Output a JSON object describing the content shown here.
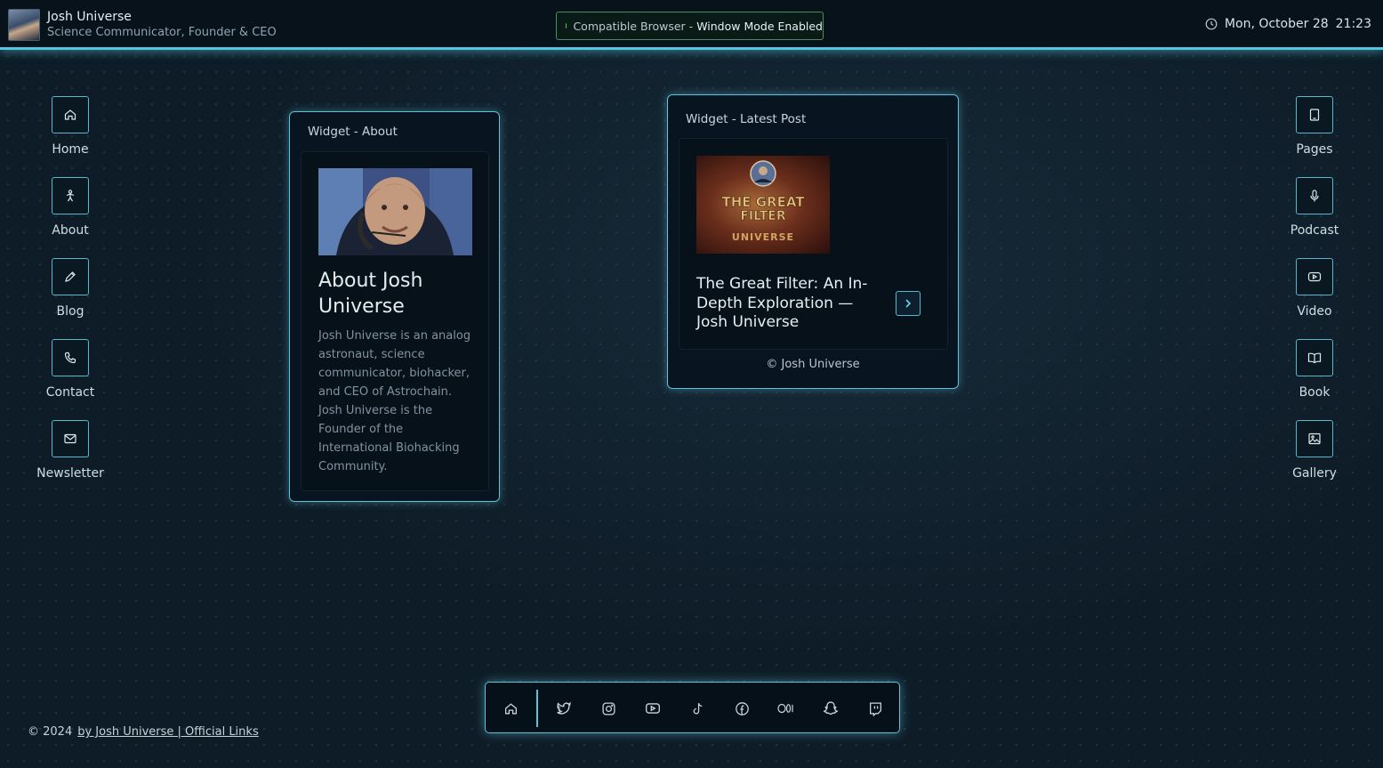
{
  "header": {
    "name": "Josh Universe",
    "subtitle": "Science Communicator, Founder & CEO",
    "browser_status_prefix": "Compatible Browser -",
    "browser_status_strong": "Window Mode Enabled",
    "date": "Mon, October 28",
    "time": "21:23"
  },
  "nav_left": [
    {
      "label": "Home",
      "icon": "home-icon"
    },
    {
      "label": "About",
      "icon": "person-icon"
    },
    {
      "label": "Blog",
      "icon": "pencil-icon"
    },
    {
      "label": "Contact",
      "icon": "phone-icon"
    },
    {
      "label": "Newsletter",
      "icon": "mail-icon"
    }
  ],
  "nav_right": [
    {
      "label": "Pages",
      "icon": "tablet-icon"
    },
    {
      "label": "Podcast",
      "icon": "microphone-icon"
    },
    {
      "label": "Video",
      "icon": "youtube-icon"
    },
    {
      "label": "Book",
      "icon": "book-icon"
    },
    {
      "label": "Gallery",
      "icon": "image-icon"
    }
  ],
  "about_widget": {
    "title": "Widget - About",
    "heading": "About Josh Universe",
    "text": "Josh Universe is an analog astronaut, science communicator, biohacker, and CEO of Astrochain. Josh Universe is the Founder of the International Biohacking Community."
  },
  "post_widget": {
    "title": "Widget - Latest Post",
    "thumb_text_1": "THE GREAT",
    "thumb_text_2": "FILTER",
    "thumb_text_3": "UNIVERSE",
    "post_title": "The Great Filter: An In-Depth Exploration — Josh Universe",
    "copyright": "© Josh Universe"
  },
  "dock": [
    "home-icon",
    "twitter-icon",
    "instagram-icon",
    "youtube-icon",
    "tiktok-icon",
    "facebook-icon",
    "medium-icon",
    "snapchat-icon",
    "twitch-icon"
  ],
  "footer": {
    "year": "© 2024",
    "link": "by Josh Universe | Official Links"
  },
  "colors": {
    "accent": "#5cc3da",
    "background": "#0e1c27",
    "status_green": "#3fcf6a"
  }
}
